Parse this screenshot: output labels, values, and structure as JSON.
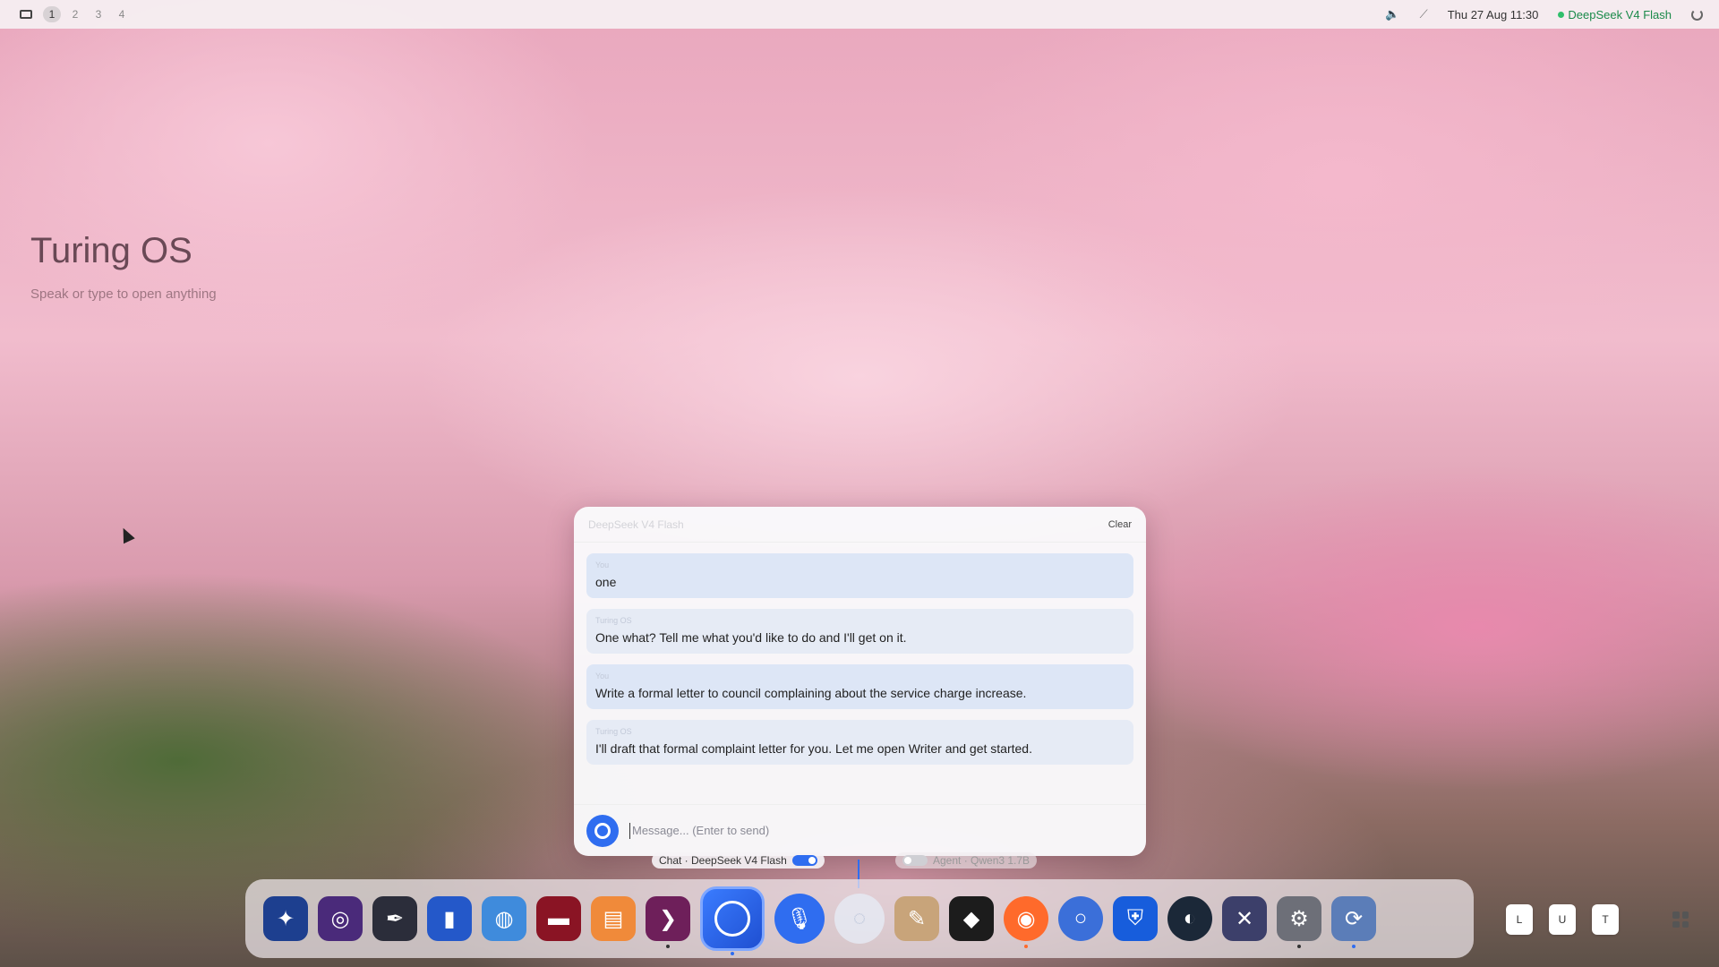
{
  "topbar": {
    "workspaces": [
      "1",
      "2",
      "3",
      "4"
    ],
    "active_workspace": "1",
    "volume_icon": "speaker-icon",
    "network_icon": "wifi-off-icon",
    "datetime": "Thu 27 Aug  11:30",
    "model_status": "DeepSeek V4 Flash",
    "model_status_color": "#2fbf6b"
  },
  "desktop": {
    "title": "Turing OS",
    "subtitle": "Speak or type to open anything"
  },
  "chat": {
    "model_label": "DeepSeek V4 Flash",
    "clear_label": "Clear",
    "messages": [
      {
        "role": "You",
        "text": "one"
      },
      {
        "role": "Turing OS",
        "text": "One what? Tell me what you'd like to do and I'll get on it."
      },
      {
        "role": "You",
        "text": "Write a formal letter to council complaining about the service charge increase."
      },
      {
        "role": "Turing OS",
        "text": "I'll draft that formal complaint letter for you. Let me open Writer and get started."
      }
    ],
    "input_placeholder": "Message... (Enter to send)"
  },
  "modes": {
    "chat_label": "Chat · DeepSeek V4 Flash",
    "agent_label": "Agent · Qwen3 1.7B"
  },
  "dock": {
    "apps": [
      {
        "name": "browser-compass-icon",
        "color": "#1d3f8f"
      },
      {
        "name": "astro-app-icon",
        "color": "#4a2a7a"
      },
      {
        "name": "inkscape-icon",
        "color": "#2b2d3a"
      },
      {
        "name": "stats-app-icon",
        "color": "#2458c9"
      },
      {
        "name": "messages-app-icon",
        "color": "#3f8bdc"
      },
      {
        "name": "media-app-icon",
        "color": "#8a1424"
      },
      {
        "name": "notes-app-icon",
        "color": "#f08a3a"
      },
      {
        "name": "terminal-app-icon",
        "color": "#6e1f5a"
      }
    ],
    "apps_right": [
      {
        "name": "gimp-icon",
        "color": "#c8a47a"
      },
      {
        "name": "cube-app-icon",
        "color": "#1c1c1c"
      },
      {
        "name": "firefox-icon",
        "color": "#ff6a2b"
      },
      {
        "name": "chromium-icon",
        "color": "#3b6fd9"
      },
      {
        "name": "bitwarden-icon",
        "color": "#175ddc"
      },
      {
        "name": "steam-icon",
        "color": "#1b2838"
      },
      {
        "name": "tools-app-icon",
        "color": "#3c3f6a"
      },
      {
        "name": "settings-gear-icon",
        "color": "#6d6f78"
      },
      {
        "name": "update-app-icon",
        "color": "#5b7db8"
      }
    ],
    "letters": [
      "L",
      "U",
      "T"
    ]
  }
}
